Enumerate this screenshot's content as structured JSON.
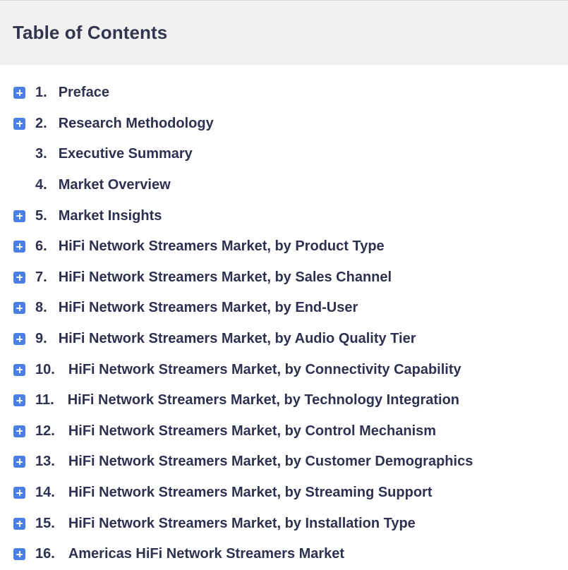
{
  "header": {
    "title": "Table of Contents"
  },
  "colors": {
    "expand_button": "#4a7fe6",
    "header_background": "#f1f1f1",
    "text": "#2e3150"
  },
  "toc": {
    "items": [
      {
        "number": "1.",
        "label": "Preface",
        "expandable": true
      },
      {
        "number": "2.",
        "label": "Research Methodology",
        "expandable": true
      },
      {
        "number": "3.",
        "label": "Executive Summary",
        "expandable": false
      },
      {
        "number": "4.",
        "label": "Market Overview",
        "expandable": false
      },
      {
        "number": "5.",
        "label": "Market Insights",
        "expandable": true
      },
      {
        "number": "6.",
        "label": "HiFi Network Streamers Market, by Product Type",
        "expandable": true
      },
      {
        "number": "7.",
        "label": "HiFi Network Streamers Market, by Sales Channel",
        "expandable": true
      },
      {
        "number": "8.",
        "label": "HiFi Network Streamers Market, by End-User",
        "expandable": true
      },
      {
        "number": "9.",
        "label": "HiFi Network Streamers Market, by Audio Quality Tier",
        "expandable": true
      },
      {
        "number": "10.",
        "label": "HiFi Network Streamers Market, by Connectivity Capability",
        "expandable": true
      },
      {
        "number": "11.",
        "label": "HiFi Network Streamers Market, by Technology Integration",
        "expandable": true
      },
      {
        "number": "12.",
        "label": "HiFi Network Streamers Market, by Control Mechanism",
        "expandable": true
      },
      {
        "number": "13.",
        "label": "HiFi Network Streamers Market, by Customer Demographics",
        "expandable": true
      },
      {
        "number": "14.",
        "label": "HiFi Network Streamers Market, by Streaming Support",
        "expandable": true
      },
      {
        "number": "15.",
        "label": "HiFi Network Streamers Market, by Installation Type",
        "expandable": true
      },
      {
        "number": "16.",
        "label": "Americas HiFi Network Streamers Market",
        "expandable": true
      }
    ]
  }
}
